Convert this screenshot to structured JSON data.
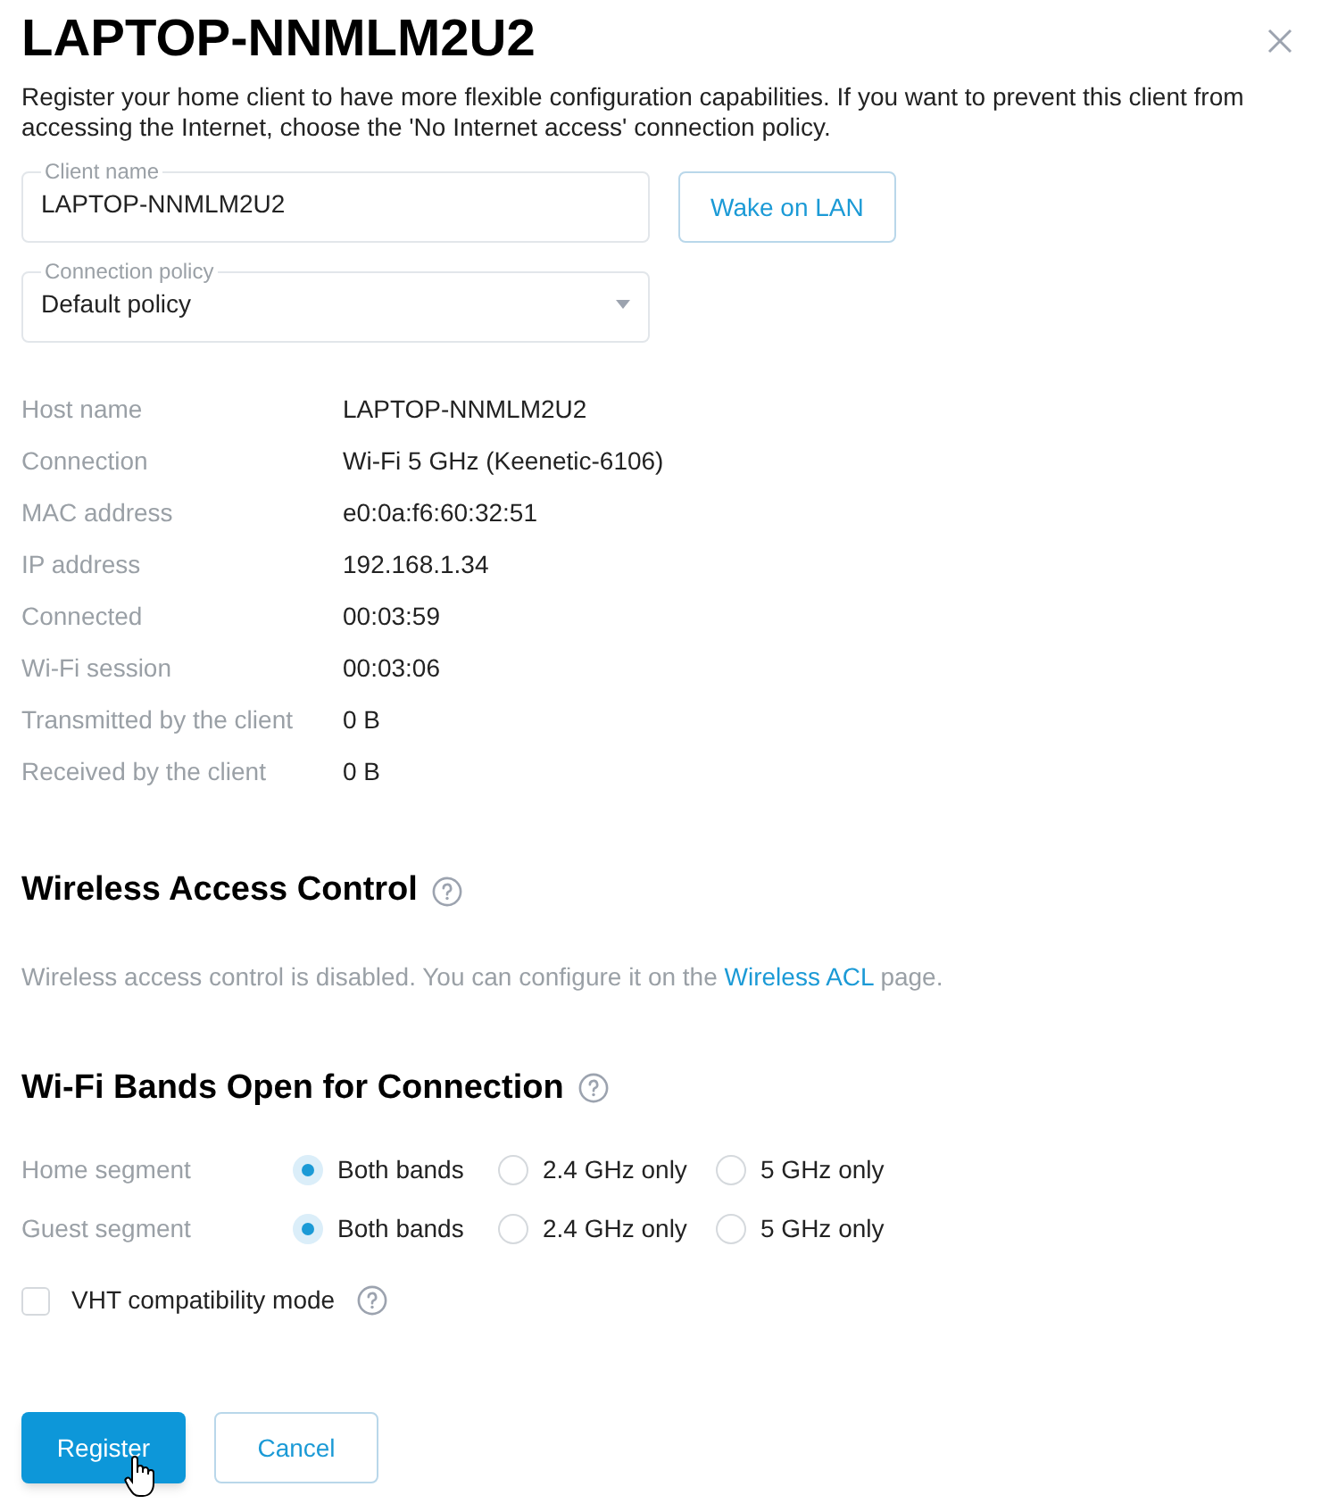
{
  "title": "LAPTOP-NNMLM2U2",
  "description": "Register your home client to have more flexible configuration capabilities. If you want to prevent this client from accessing the Internet, choose the 'No Internet access' connection policy.",
  "client_name": {
    "label": "Client name",
    "value": "LAPTOP-NNMLM2U2"
  },
  "wake_button": "Wake on LAN",
  "connection_policy": {
    "label": "Connection policy",
    "value": "Default policy"
  },
  "info": [
    {
      "label": "Host name",
      "value": "LAPTOP-NNMLM2U2"
    },
    {
      "label": "Connection",
      "value": "Wi-Fi 5 GHz (Keenetic-6106)"
    },
    {
      "label": "MAC address",
      "value": "e0:0a:f6:60:32:51"
    },
    {
      "label": "IP address",
      "value": "192.168.1.34"
    },
    {
      "label": "Connected",
      "value": "00:03:59"
    },
    {
      "label": "Wi-Fi session",
      "value": "00:03:06"
    },
    {
      "label": "Transmitted by the client",
      "value": "0 B"
    },
    {
      "label": "Received by the client",
      "value": "0 B"
    }
  ],
  "wireless_access_control": {
    "heading": "Wireless Access Control",
    "text_before": "Wireless access control is disabled. You can configure it on the",
    "link": "Wireless ACL",
    "text_after": "page."
  },
  "wifi_bands": {
    "heading": "Wi-Fi Bands Open for Connection",
    "segments": [
      {
        "label": "Home segment",
        "options": [
          {
            "label": "Both bands",
            "selected": true
          },
          {
            "label": "2.4 GHz only",
            "selected": false
          },
          {
            "label": "5 GHz only",
            "selected": false
          }
        ]
      },
      {
        "label": "Guest segment",
        "options": [
          {
            "label": "Both bands",
            "selected": true
          },
          {
            "label": "2.4 GHz only",
            "selected": false
          },
          {
            "label": "5 GHz only",
            "selected": false
          }
        ]
      }
    ],
    "vht": {
      "label": "VHT compatibility mode",
      "checked": false
    }
  },
  "buttons": [
    {
      "label": "Register",
      "kind": "primary"
    },
    {
      "label": "Cancel",
      "kind": "secondary"
    }
  ]
}
